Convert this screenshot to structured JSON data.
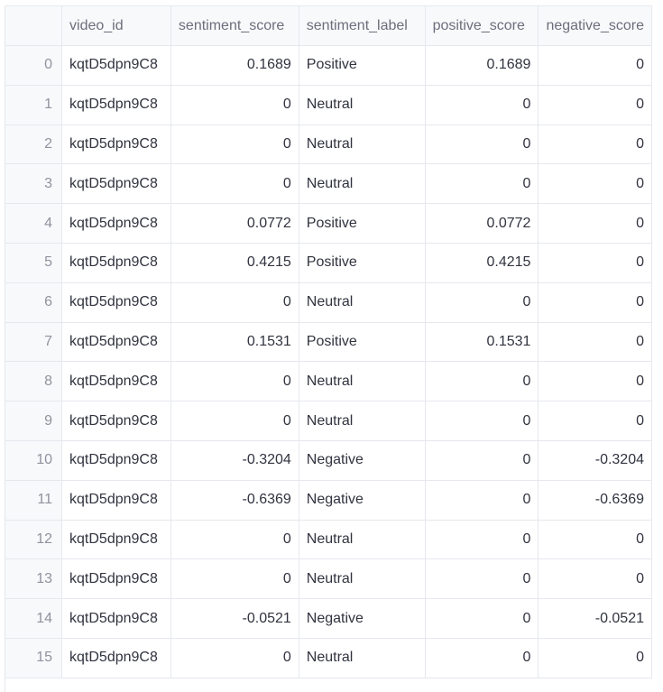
{
  "table": {
    "columns": [
      "",
      "video_id",
      "sentiment_score",
      "sentiment_label",
      "positive_score",
      "negative_score"
    ],
    "rows": [
      {
        "index": "0",
        "video_id": "kqtD5dpn9C8",
        "sentiment_score": "0.1689",
        "sentiment_label": "Positive",
        "positive_score": "0.1689",
        "negative_score": "0"
      },
      {
        "index": "1",
        "video_id": "kqtD5dpn9C8",
        "sentiment_score": "0",
        "sentiment_label": "Neutral",
        "positive_score": "0",
        "negative_score": "0"
      },
      {
        "index": "2",
        "video_id": "kqtD5dpn9C8",
        "sentiment_score": "0",
        "sentiment_label": "Neutral",
        "positive_score": "0",
        "negative_score": "0"
      },
      {
        "index": "3",
        "video_id": "kqtD5dpn9C8",
        "sentiment_score": "0",
        "sentiment_label": "Neutral",
        "positive_score": "0",
        "negative_score": "0"
      },
      {
        "index": "4",
        "video_id": "kqtD5dpn9C8",
        "sentiment_score": "0.0772",
        "sentiment_label": "Positive",
        "positive_score": "0.0772",
        "negative_score": "0"
      },
      {
        "index": "5",
        "video_id": "kqtD5dpn9C8",
        "sentiment_score": "0.4215",
        "sentiment_label": "Positive",
        "positive_score": "0.4215",
        "negative_score": "0"
      },
      {
        "index": "6",
        "video_id": "kqtD5dpn9C8",
        "sentiment_score": "0",
        "sentiment_label": "Neutral",
        "positive_score": "0",
        "negative_score": "0"
      },
      {
        "index": "7",
        "video_id": "kqtD5dpn9C8",
        "sentiment_score": "0.1531",
        "sentiment_label": "Positive",
        "positive_score": "0.1531",
        "negative_score": "0"
      },
      {
        "index": "8",
        "video_id": "kqtD5dpn9C8",
        "sentiment_score": "0",
        "sentiment_label": "Neutral",
        "positive_score": "0",
        "negative_score": "0"
      },
      {
        "index": "9",
        "video_id": "kqtD5dpn9C8",
        "sentiment_score": "0",
        "sentiment_label": "Neutral",
        "positive_score": "0",
        "negative_score": "0"
      },
      {
        "index": "10",
        "video_id": "kqtD5dpn9C8",
        "sentiment_score": "-0.3204",
        "sentiment_label": "Negative",
        "positive_score": "0",
        "negative_score": "-0.3204"
      },
      {
        "index": "11",
        "video_id": "kqtD5dpn9C8",
        "sentiment_score": "-0.6369",
        "sentiment_label": "Negative",
        "positive_score": "0",
        "negative_score": "-0.6369"
      },
      {
        "index": "12",
        "video_id": "kqtD5dpn9C8",
        "sentiment_score": "0",
        "sentiment_label": "Neutral",
        "positive_score": "0",
        "negative_score": "0"
      },
      {
        "index": "13",
        "video_id": "kqtD5dpn9C8",
        "sentiment_score": "0",
        "sentiment_label": "Neutral",
        "positive_score": "0",
        "negative_score": "0"
      },
      {
        "index": "14",
        "video_id": "kqtD5dpn9C8",
        "sentiment_score": "-0.0521",
        "sentiment_label": "Negative",
        "positive_score": "0",
        "negative_score": "-0.0521"
      },
      {
        "index": "15",
        "video_id": "kqtD5dpn9C8",
        "sentiment_score": "0",
        "sentiment_label": "Neutral",
        "positive_score": "0",
        "negative_score": "0"
      }
    ]
  }
}
